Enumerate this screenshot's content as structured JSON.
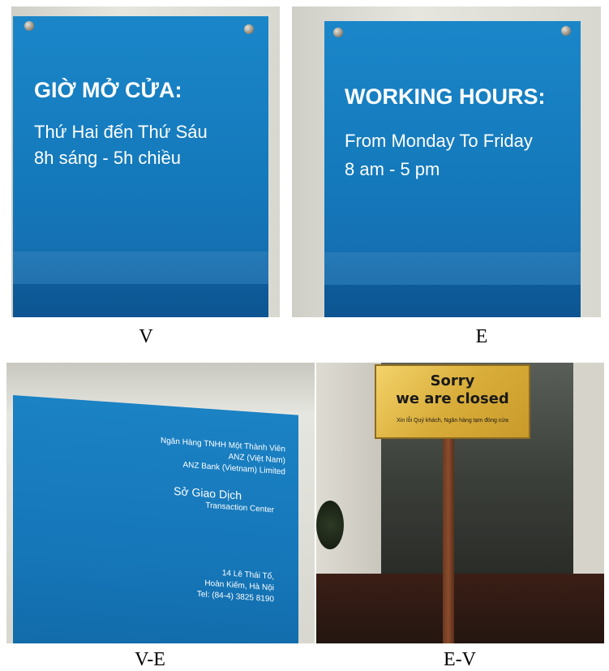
{
  "panels": {
    "v": {
      "caption": "V",
      "heading": "GIỜ MỞ CỬA:",
      "line1": "Thứ Hai đến Thứ Sáu",
      "line2": "8h sáng - 5h chiều"
    },
    "e": {
      "caption": "E",
      "heading": "WORKING HOURS:",
      "line1": "From Monday To Friday",
      "line2": "8 am - 5 pm"
    },
    "ve": {
      "caption": "V-E",
      "bank_vn": "Ngân Hàng TNHH Một Thành Viên",
      "bank_short": "ANZ (Việt Nam)",
      "bank_en": "ANZ Bank (Vietnam) Limited",
      "center_vn": "Sở Giao Dịch",
      "center_en": "Transaction Center",
      "address1": "14 Lê Thái Tổ,",
      "address2": "Hoàn Kiếm, Hà Nội",
      "phone": "Tel: (84-4) 3825 8190"
    },
    "ev": {
      "caption": "E-V",
      "line1": "Sorry",
      "line2": "we are closed",
      "line3": "Xin lỗi Quý khách, Ngân hàng tạm đóng cửa"
    }
  }
}
